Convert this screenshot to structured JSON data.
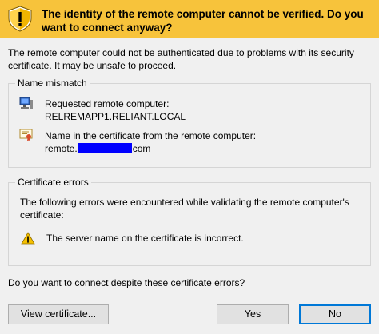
{
  "header": {
    "title": "The identity of the remote computer cannot be verified. Do you want to connect anyway?"
  },
  "intro": "The remote computer could not be authenticated due to problems with its security certificate. It may be unsafe to proceed.",
  "name_mismatch": {
    "legend": "Name mismatch",
    "requested_label": "Requested remote computer:",
    "requested_value": "RELREMAPP1.RELIANT.LOCAL",
    "cert_label": "Name in the certificate from the remote computer:",
    "cert_value_prefix": "remote.",
    "cert_value_suffix": "com"
  },
  "certificate_errors": {
    "legend": "Certificate errors",
    "description": "The following errors were encountered while validating the remote computer's certificate:",
    "error": "The server name on the certificate is incorrect."
  },
  "question": "Do you want to connect despite these certificate errors?",
  "buttons": {
    "view_certificate": "View certificate...",
    "yes": "Yes",
    "no": "No"
  },
  "colors": {
    "banner": "#f7c33b",
    "redaction": "#0000ff",
    "focus_border": "#0078d7"
  }
}
